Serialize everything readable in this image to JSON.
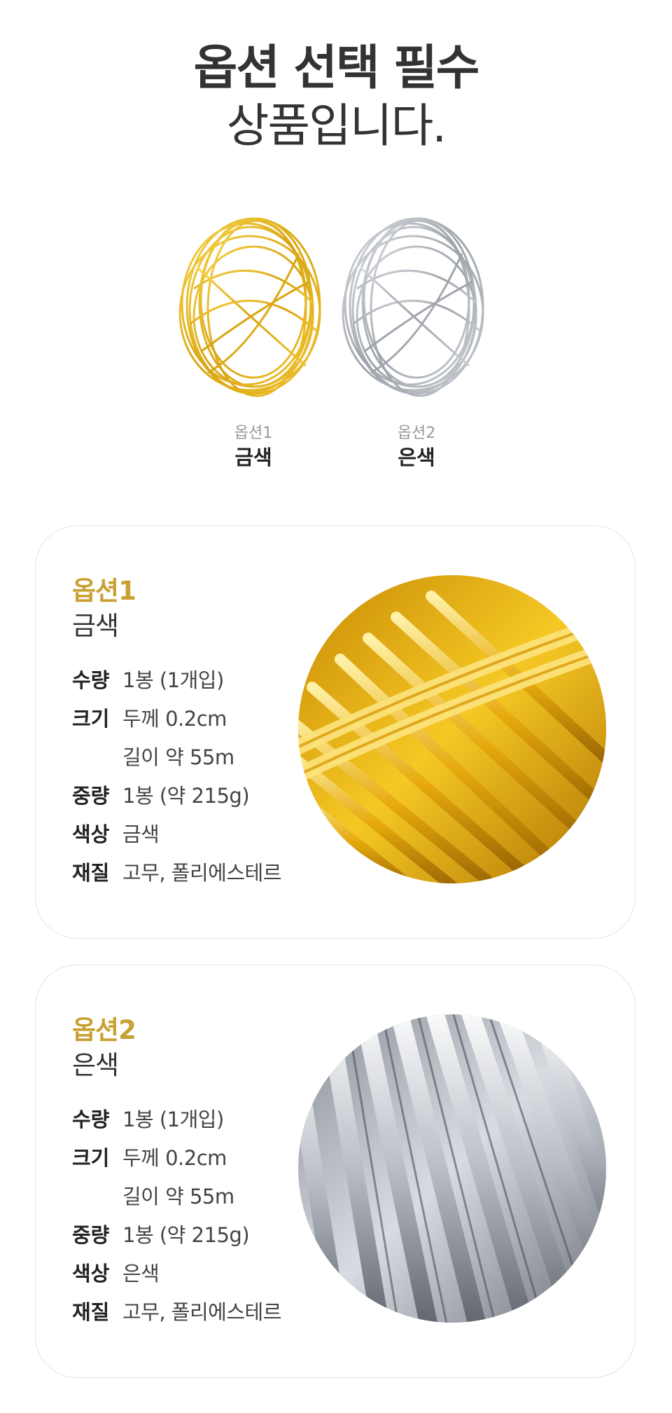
{
  "header": {
    "line1": "옵션 선택 필수",
    "line2": "상품입니다."
  },
  "thumbnails": [
    {
      "sub": "옵션1",
      "name": "금색"
    },
    {
      "sub": "옵션2",
      "name": "은색"
    }
  ],
  "options": [
    {
      "label": "옵션1",
      "name": "금색",
      "specs": [
        {
          "key": "수량",
          "value": "1봉 (1개입)"
        },
        {
          "key": "크기",
          "value": "두께 0.2cm"
        },
        {
          "key": "",
          "value": "길이 약 55m"
        },
        {
          "key": "중량",
          "value": "1봉 (약 215g)"
        },
        {
          "key": "색상",
          "value": "금색"
        },
        {
          "key": "재질",
          "value": "고무, 폴리에스테르"
        }
      ]
    },
    {
      "label": "옵션2",
      "name": "은색",
      "specs": [
        {
          "key": "수량",
          "value": "1봉 (1개입)"
        },
        {
          "key": "크기",
          "value": "두께 0.2cm"
        },
        {
          "key": "",
          "value": "길이 약 55m"
        },
        {
          "key": "중량",
          "value": "1봉 (약 215g)"
        },
        {
          "key": "색상",
          "value": "은색"
        },
        {
          "key": "재질",
          "value": "고무, 폴리에스테르"
        }
      ]
    }
  ],
  "colors": {
    "accent": "#c9a032",
    "gold": "#e8b820",
    "silver": "#b8bcc4"
  }
}
